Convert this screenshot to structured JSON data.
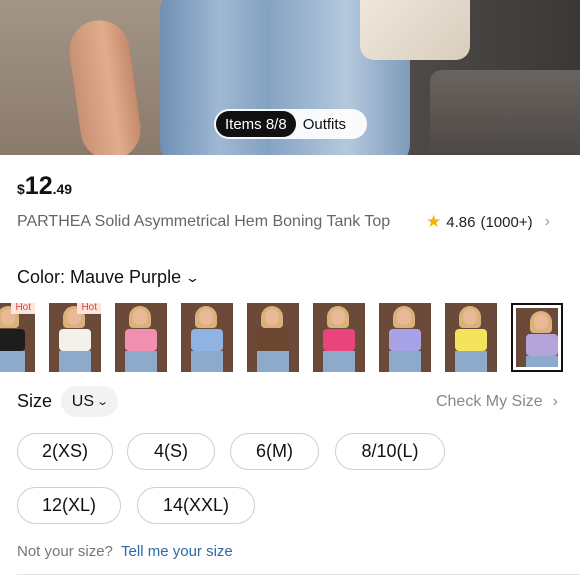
{
  "gallery": {
    "items_label": "Items 8/8",
    "outfits_label": "Outfits"
  },
  "product": {
    "price_currency": "$",
    "price_int": "12",
    "price_dec": ".49",
    "title": "PARTHEA Solid Asymmetrical Hem Boning Tank Top",
    "rating_value": "4.86",
    "rating_count": "(1000+)",
    "star_icon": "star-icon"
  },
  "color": {
    "label": "Color: Mauve Purple",
    "swatches": [
      {
        "color": "#1d1d1d",
        "badge": "Hot",
        "selected": false
      },
      {
        "color": "#f4f1ec",
        "badge": "Hot",
        "selected": false
      },
      {
        "color": "#f08fb0",
        "badge": "",
        "selected": false
      },
      {
        "color": "#8fb4e3",
        "badge": "",
        "selected": false
      },
      {
        "color": "#6d4630",
        "badge": "",
        "selected": false
      },
      {
        "color": "#e8457d",
        "badge": "",
        "selected": false
      },
      {
        "color": "#a8a3e6",
        "badge": "",
        "selected": false
      },
      {
        "color": "#f3e35d",
        "badge": "",
        "selected": false
      },
      {
        "color": "#b5a4da",
        "badge": "",
        "selected": true
      }
    ]
  },
  "size": {
    "label": "Size",
    "unit": "US",
    "check_label": "Check My Size",
    "options": [
      "2(XS)",
      "4(S)",
      "6(M)",
      "8/10(L)",
      "12(XL)",
      "14(XXL)"
    ],
    "hint_text": "Not your size?",
    "hint_link": "Tell me your size"
  }
}
